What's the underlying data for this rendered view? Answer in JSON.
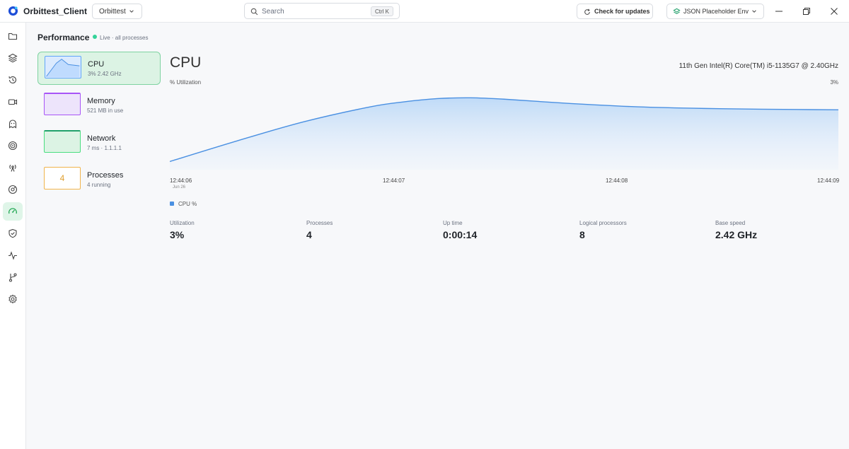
{
  "app": {
    "name": "Orbittest_Client"
  },
  "titlebar": {
    "workspace": "Orbittest",
    "search_placeholder": "Search",
    "search_shortcut": "Ctrl K",
    "updates_label": "Check for updates",
    "environment": "JSON Placeholder Env"
  },
  "sidebar": {
    "items": [
      "folder-icon",
      "layers-icon",
      "history-icon",
      "video-icon",
      "ghost-icon",
      "target-icon",
      "antenna-icon",
      "settings-alt-icon",
      "gauge-icon",
      "shield-icon",
      "activity-icon",
      "git-branch-icon",
      "gear-icon"
    ],
    "active": "gauge-icon"
  },
  "performance": {
    "title": "Performance",
    "live_text": "Live · all processes",
    "cards": [
      {
        "name": "CPU",
        "sub": "3% 2.42 GHz"
      },
      {
        "name": "Memory",
        "sub": "521 MB in use"
      },
      {
        "name": "Network",
        "sub": "7 ms · 1.1.1.1"
      },
      {
        "name": "Processes",
        "sub": "4 running",
        "count": "4"
      }
    ]
  },
  "detail": {
    "title": "CPU",
    "model": "11th Gen Intel(R) Core(TM) i5-1135G7 @ 2.40GHz",
    "util_label": "% Utilization",
    "util_max": "3%",
    "date_sub": "Jun 26",
    "legend": "CPU %",
    "stats": [
      {
        "label": "Utilization",
        "value": "3%"
      },
      {
        "label": "Processes",
        "value": "4"
      },
      {
        "label": "Up time",
        "value": "0:00:14"
      },
      {
        "label": "Logical processors",
        "value": "8"
      },
      {
        "label": "Base speed",
        "value": "2.42 GHz"
      }
    ]
  },
  "colors": {
    "accent_green": "#34d399",
    "series_blue": "#4a90e2",
    "memory_purple": "#a855f7",
    "processes_orange": "#e0a030"
  },
  "chart_data": {
    "type": "area",
    "xlabel": "",
    "ylabel": "% Utilization",
    "x_ticks": [
      "12:44:06",
      "12:44:07",
      "12:44:08",
      "12:44:09"
    ],
    "ylim": [
      0,
      3
    ],
    "series": [
      {
        "name": "CPU %",
        "x": [
          0,
          0.1,
          0.2,
          0.3,
          0.35,
          0.4,
          0.45,
          0.5,
          0.6,
          0.7,
          0.8,
          0.9,
          1.0
        ],
        "values": [
          0.3,
          1.05,
          1.75,
          2.3,
          2.48,
          2.6,
          2.63,
          2.58,
          2.42,
          2.3,
          2.24,
          2.21,
          2.19
        ]
      }
    ]
  }
}
